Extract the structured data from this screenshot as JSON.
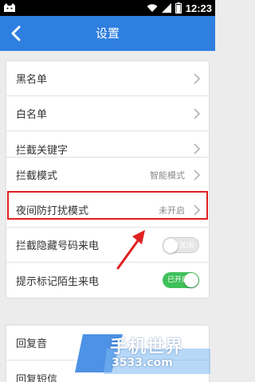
{
  "status_bar": {
    "time": "12:23",
    "icons": [
      "cat-icon",
      "wifi-icon",
      "signal-icon",
      "battery-icon"
    ]
  },
  "app_bar": {
    "title": "设置",
    "back_icon": "chevron-left-icon"
  },
  "section1": {
    "items": [
      {
        "label": "黑名单"
      },
      {
        "label": "白名单"
      },
      {
        "label": "拦截关键字"
      }
    ]
  },
  "section2": {
    "items": [
      {
        "label": "拦截模式",
        "value": "智能模式"
      },
      {
        "label": "夜间防打扰模式",
        "value": "未开启"
      },
      {
        "label": "拦截隐藏号码来电",
        "toggle_text": "已关闭",
        "toggle_state": "off"
      },
      {
        "label": "提示标记陌生来电",
        "toggle_text": "已开启",
        "toggle_state": "on"
      }
    ]
  },
  "section3": {
    "items": [
      {
        "label": "回复音"
      },
      {
        "label": "回复短信"
      }
    ]
  },
  "watermark": {
    "brand": "手机世界",
    "site": "3533.com"
  },
  "colors": {
    "accent": "#2f7fe0",
    "toggle_on": "#40c05a",
    "highlight": "#e02020"
  }
}
